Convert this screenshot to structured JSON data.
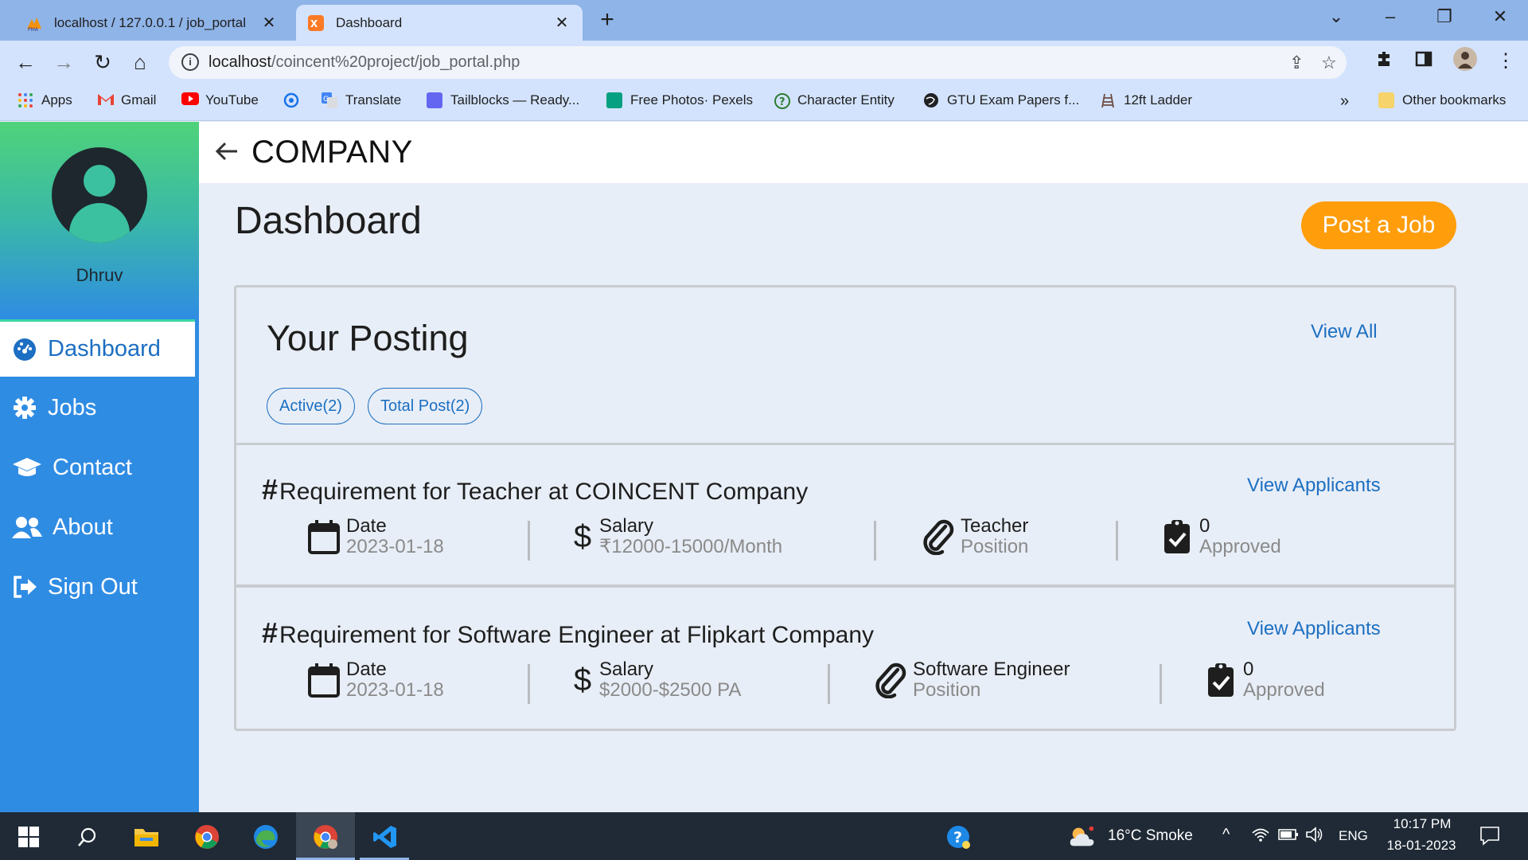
{
  "browser": {
    "tabs": [
      {
        "title": "localhost / 127.0.0.1 / job_portal",
        "active": false,
        "close": "✕"
      },
      {
        "title": "Dashboard",
        "active": true,
        "close": "✕"
      }
    ],
    "new_tab": "+",
    "url_host": "localhost",
    "url_path": "/coincent%20project/job_portal.php",
    "bookmarks": [
      {
        "label": "Apps",
        "icon": "apps-grid-icon",
        "color": "#ea4335"
      },
      {
        "label": "Gmail",
        "icon": "gmail-icon",
        "color": "#ea4335"
      },
      {
        "label": "YouTube",
        "icon": "youtube-icon",
        "color": "#ff0000"
      },
      {
        "label": "",
        "icon": "sync-icon",
        "color": "#1a73e8"
      },
      {
        "label": "Translate",
        "icon": "translate-icon",
        "color": "#4285f4"
      },
      {
        "label": "Tailblocks — Ready...",
        "icon": "tailblocks-icon",
        "color": "#6366f1"
      },
      {
        "label": "Free Photos· Pexels",
        "icon": "pexels-icon",
        "color": "#05a081"
      },
      {
        "label": "Character Entity",
        "icon": "question-circle-icon",
        "color": "#2e7d32"
      },
      {
        "label": "GTU Exam Papers f...",
        "icon": "globe-icon",
        "color": "#202124"
      },
      {
        "label": "12ft Ladder",
        "icon": "ladder-icon",
        "color": "#6d4c41"
      }
    ],
    "more_bookmarks": "»",
    "other_bookmarks": "Other bookmarks"
  },
  "sidebar": {
    "username": "Dhruv",
    "items": [
      {
        "label": "Dashboard",
        "icon": "dashboard-gauge-icon",
        "active": true
      },
      {
        "label": "Jobs",
        "icon": "gear-icon",
        "active": false
      },
      {
        "label": "Contact",
        "icon": "graduation-cap-icon",
        "active": false
      },
      {
        "label": "About",
        "icon": "users-icon",
        "active": false
      },
      {
        "label": "Sign Out",
        "icon": "sign-out-icon",
        "active": false
      }
    ]
  },
  "header": {
    "title": "COMPANY",
    "back_icon": "arrow-left-icon"
  },
  "main": {
    "page_title": "Dashboard",
    "post_job_label": "Post a Job",
    "panel": {
      "title": "Your Posting",
      "view_all": "View All",
      "pills": [
        "Active(2)",
        "Total Post(2)"
      ]
    },
    "jobs": [
      {
        "hash": "#",
        "title": "Requirement for Teacher at COINCENT Company",
        "view_applicants": "View Applicants",
        "date_label": "Date",
        "date": "2023-01-18",
        "salary_label": "Salary",
        "salary": "₹12000-15000/Month",
        "position_value": "Teacher",
        "position_label": "Position",
        "approved_count": "0",
        "approved_label": "Approved"
      },
      {
        "hash": "#",
        "title": "Requirement for Software Engineer at Flipkart Company",
        "view_applicants": "View Applicants",
        "date_label": "Date",
        "date": "2023-01-18",
        "salary_label": "Salary",
        "salary": "$2000-$2500 PA",
        "position_value": "Software Engineer",
        "position_label": "Position",
        "approved_count": "0",
        "approved_label": "Approved"
      }
    ]
  },
  "taskbar": {
    "weather": "16°C  Smoke",
    "language": "ENG",
    "time": "10:17 PM",
    "date": "18-01-2023"
  },
  "colors": {
    "accent_blue": "#2f8ce3",
    "link_blue": "#1c6fc2",
    "post_button": "#ff9d0b",
    "sidebar_gradient_top": "#4fd37a"
  }
}
